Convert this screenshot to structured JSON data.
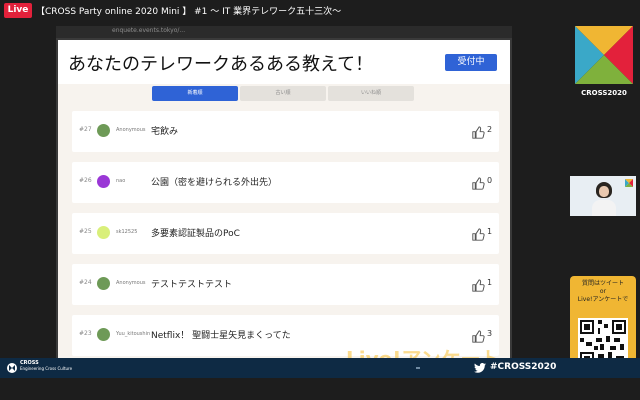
{
  "stream": {
    "live_label": "Live",
    "title": "【CROSS Party online 2020 Mini 】 #1 〜 IT 業界テレワーク五十三次〜"
  },
  "browser": {
    "url": "enquete.events.tokyo/..."
  },
  "question": {
    "text": "あなたのテレワークあるある教えて！",
    "status": "受付中"
  },
  "tabs": [
    {
      "label": "新着順",
      "active": true
    },
    {
      "label": "古い順",
      "active": false
    },
    {
      "label": "いいね順",
      "active": false
    }
  ],
  "posts": [
    {
      "num": "#27",
      "user": "Anonymous",
      "avatar_color": "#6e9a57",
      "text": "宅飲み",
      "likes": "2"
    },
    {
      "num": "#26",
      "user": "nao",
      "avatar_color": "#9a37d6",
      "text": "公園（密を避けられる外出先）",
      "likes": "0"
    },
    {
      "num": "#25",
      "user": "sk12525",
      "avatar_color": "#d9ef7a",
      "text": "多要素認証製品のPoC",
      "likes": "1"
    },
    {
      "num": "#24",
      "user": "Anonymous",
      "avatar_color": "#6e9a57",
      "text": "テストテストテスト",
      "likes": "1"
    },
    {
      "num": "#23",
      "user": "Yuu_kitoushina...",
      "avatar_color": "#6e9a57",
      "text": "Netflix！ 聖闘士星矢見まくってた",
      "likes": "3"
    }
  ],
  "watermark": "Live!アンケート",
  "sidebar": {
    "logo_text": "CROSS2020",
    "cta_line1": "質問はツイート",
    "cta_line2": "or",
    "cta_line3": "Live!アンケートで"
  },
  "bottom": {
    "brand": "CROSS",
    "brand_sub": "Engineering Cross Culture",
    "hashtag": "#CROSS2020"
  },
  "colors": {
    "accent": "#2f63d6",
    "live_red": "#e3213b",
    "cta_yellow": "#f0b633",
    "bottom_navy": "#0e2a44"
  }
}
